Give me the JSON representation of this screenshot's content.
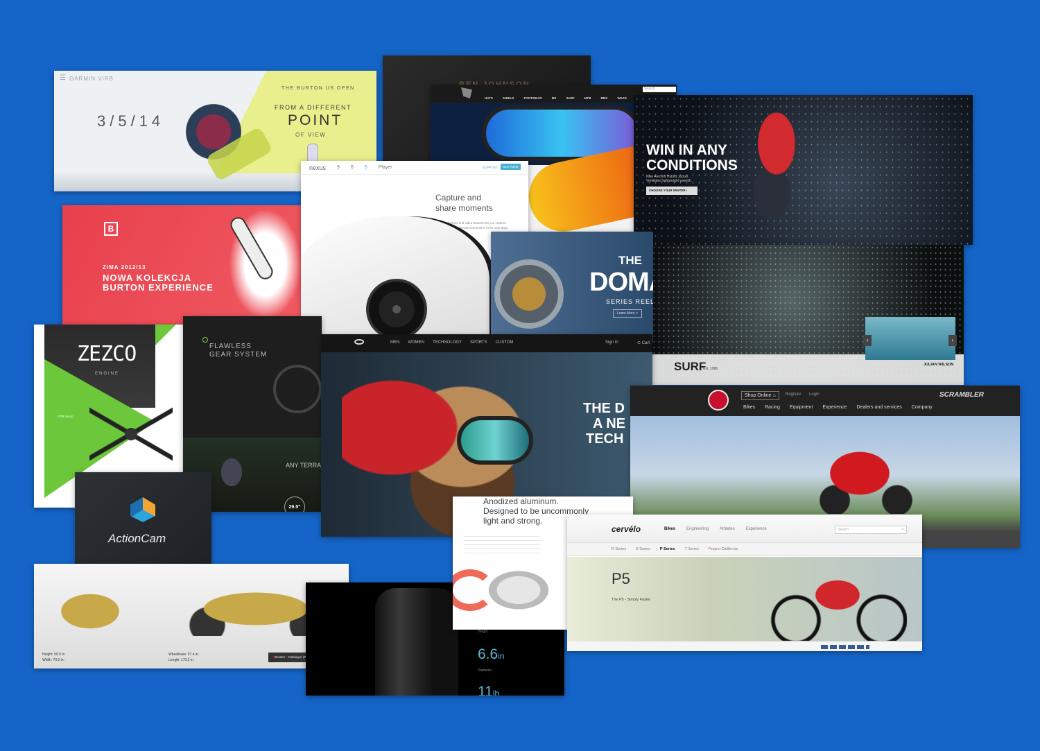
{
  "colors": {
    "background": "#1565c8"
  },
  "garmin": {
    "brand": "GARMIN",
    "brand_suffix": "VIRB",
    "date": "3/5/14",
    "kicker": "THE BURTON US OPEN",
    "line1": "FROM A DIFFERENT",
    "line2": "POINT",
    "line3": "OF VIEW"
  },
  "burton": {
    "season": "ZIMA 2012/13",
    "title1": "NOWA KOLEKCJA",
    "title2": "BURTON EXPERIENCE"
  },
  "benjohnson": {
    "name": "BEN JOHNSON"
  },
  "fox": {
    "nav": [
      "HATS",
      "SHIELD",
      "FOOTWEAR",
      "MX",
      "SURF",
      "MTB",
      "BMX",
      "WAKE",
      "STREWEAR",
      "ACTIVE"
    ],
    "search": "Search"
  },
  "nike": {
    "headline1": "WIN IN ANY",
    "headline2": "CONDITIONS",
    "sub1": "Nike Aeroloft Hybrid Jacket.",
    "sub2": "Ventilated lightweight warmth.",
    "cta": "CHOOSE YOUR WINTER"
  },
  "nexus": {
    "brand": "nexus",
    "nav": [
      "9",
      "6",
      "5",
      "Player"
    ],
    "support": "SUPPORT",
    "cta": "BUY NOW",
    "title1": "Capture and",
    "title2": "share moments",
    "body": "Advanced photo and video features let you capture and share those special moments in fresh new ways."
  },
  "domain": {
    "the": "THE",
    "word": "DOMAI",
    "series": "SERIES REELS",
    "btn": "Learn More >"
  },
  "surf": {
    "word": "SURF",
    "est": "Est. 1986",
    "surfer": "JULIAN WILSON"
  },
  "zezco": {
    "name": "ZEZCO",
    "sub": "ENGINE",
    "label": "FOR SALE"
  },
  "flawless": {
    "line1": "FLAWLESS",
    "line2": "GEAR SYSTEM",
    "terrain": "ANY TERRA",
    "wheel": "29.5\""
  },
  "oakley": {
    "nav": [
      "MEN",
      "WOMEN",
      "TECHNOLOGY",
      "SPORTS",
      "CUSTOM"
    ],
    "signin": "Sign In",
    "cart": "Cart",
    "h1": "THE D",
    "h2": "A NE",
    "h3": "TECH"
  },
  "ducati": {
    "shop": "Shop Online",
    "register": "Register",
    "login": "Login",
    "scrambler": "SCRAMBLER",
    "nav": [
      "Bikes",
      "Racing",
      "Equipment",
      "Experience",
      "Dealers and services",
      "Company"
    ]
  },
  "actioncam": {
    "name": "ActionCam"
  },
  "watch": {
    "h1": "Anodized aluminum.",
    "h2": "Designed to be uncommonly",
    "h3": "light and strong."
  },
  "cervelo": {
    "brand": "cervélo",
    "nav": [
      "Bikes",
      "Engineering",
      "Athletes",
      "Experience"
    ],
    "search": "Search",
    "sub": [
      "R Series",
      "S Series",
      "P Series",
      "T Series",
      "Project California"
    ],
    "model": "P5",
    "tagline": "The P5 - Simply Faster"
  },
  "porsche": {
    "height": "Height: 50.5 in.",
    "width": "Width: 70.0 in.",
    "wheelbase": "Wheelbase: 97.4 in.",
    "length": "Length: 172.2 in.",
    "btn": "Boxster - Catalogue (PDF; 4.2 MB)"
  },
  "macpro": {
    "label1": "Height",
    "val1": "6.6",
    "unit1": "in",
    "label2": "Diameter",
    "val2": "11",
    "unit2": "lb"
  }
}
